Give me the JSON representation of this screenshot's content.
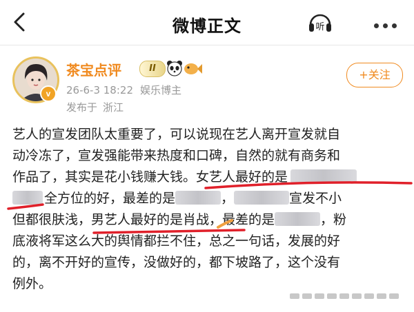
{
  "header": {
    "title": "微博正文",
    "listen_label": "听"
  },
  "author": {
    "name": "茶宝点评",
    "vip_level": "II",
    "time": "26-6-3 18:22",
    "tag": "娱乐博主",
    "posted_from_label": "发布于",
    "location": "浙江",
    "verified_mark": "v",
    "follow_label": "+关注"
  },
  "post": {
    "lines": [
      [
        "艺人的宣发团队太重要了，可以说现在艺人离开宣发就自"
      ],
      [
        "动冷冻了，宣发强能带来热度和口碑，自然的就有商务和"
      ],
      [
        "作品了，其实是花小钱赚大钱。女艺人最好的是"
      ],
      [
        "全方位的好，最差的是",
        "，",
        "宣发不小"
      ],
      [
        "但都很肤浅，",
        "男艺人最好的是肖战",
        "，最差的是",
        "，粉"
      ],
      [
        "底液将军这么大的舆情都拦不住，总之一句话，发展的好"
      ],
      [
        "的，离不开好的宣传，没做好的，都下坡路了，这个没有"
      ],
      [
        "例外。"
      ]
    ]
  },
  "colors": {
    "accent": "#f08a1f",
    "annotation_red": "#e0202a",
    "annotation_orange": "#f0a040"
  }
}
